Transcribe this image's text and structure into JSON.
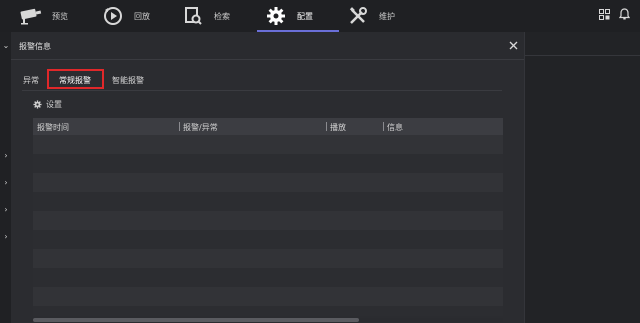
{
  "topbar": {
    "items": [
      {
        "label": "预览",
        "icon": "camera-icon"
      },
      {
        "label": "回放",
        "icon": "playback-icon"
      },
      {
        "label": "检索",
        "icon": "search-doc-icon"
      },
      {
        "label": "配置",
        "icon": "gear-icon",
        "active": true
      },
      {
        "label": "维护",
        "icon": "tools-icon"
      }
    ],
    "right_icons": [
      "grid-icon",
      "bell-icon"
    ]
  },
  "panel": {
    "title": "报警信息",
    "tabs": [
      "异常",
      "常规报警",
      "智能报警"
    ],
    "active_tab": "常规报警",
    "settings_label": "设置",
    "table": {
      "columns": [
        "报警时间",
        "报警/异常",
        "播放",
        "信息"
      ],
      "rows": []
    }
  },
  "colors": {
    "accent": "#6a6fd8",
    "highlight_box": "#e0282a",
    "background": "#26272b"
  }
}
